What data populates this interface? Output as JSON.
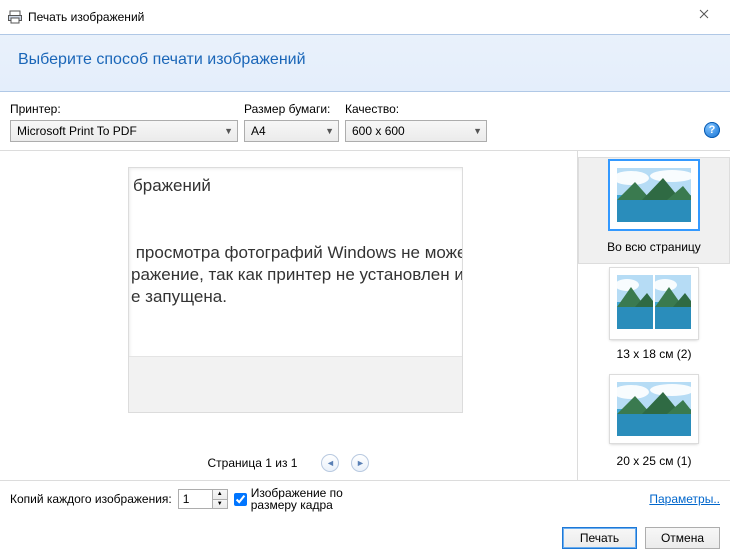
{
  "title": "Печать изображений",
  "heading": "Выберите способ печати изображений",
  "labels": {
    "printer": "Принтер:",
    "paper": "Размер бумаги:",
    "quality": "Качество:",
    "page_of": "Страница 1 из 1",
    "copies": "Копий каждого изображения:",
    "fit": "Изображение по\nразмеру кадра",
    "params": "Параметры..",
    "print": "Печать",
    "cancel": "Отмена"
  },
  "combos": {
    "printer": "Microsoft Print To PDF",
    "paper": "A4",
    "quality": "600 x 600"
  },
  "copies_value": "1",
  "fit_checked": true,
  "layouts": [
    {
      "label": "Во всю страницу",
      "selected": true
    },
    {
      "label": "13 x 18 см (2)",
      "selected": false
    },
    {
      "label": "20 x 25 см (1)",
      "selected": false
    }
  ],
  "preview": {
    "title_snippet": "бражений",
    "body_snippet": " просмотра фотографий Windows не может\nражение, так как принтер не установлен или\nе запущена."
  }
}
